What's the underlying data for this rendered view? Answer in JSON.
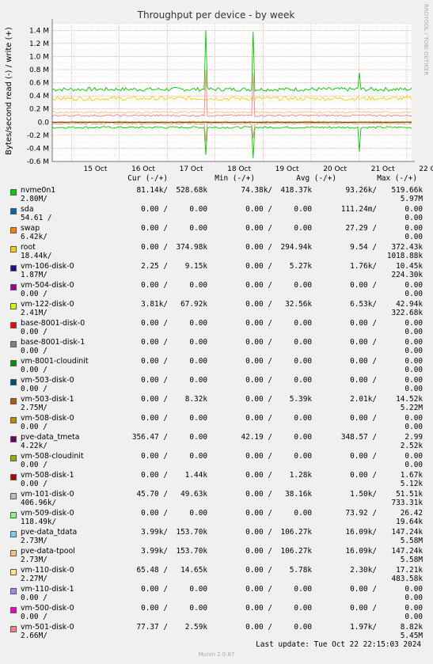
{
  "chart_data": {
    "type": "line",
    "title": "Throughput per device - by week",
    "ylabel": "Bytes/second read (-) / write (+)",
    "side_label": "RRDTOOL / TOBI OETIKER",
    "yticks": [
      "1.4 M",
      "1.2 M",
      "1.0 M",
      "0.8 M",
      "0.6 M",
      "0.4 M",
      "0.2 M",
      "0.0",
      "-0.2 M",
      "-0.4 M",
      "-0.6 M"
    ],
    "ytick_values": [
      1.4,
      1.2,
      1.0,
      0.8,
      0.6,
      0.4,
      0.2,
      0.0,
      -0.2,
      -0.4,
      -0.6
    ],
    "ylim": [
      -0.6,
      1.5
    ],
    "xticks": [
      "15 Oct",
      "16 Oct",
      "17 Oct",
      "18 Oct",
      "19 Oct",
      "20 Oct",
      "21 Oct",
      "22 Oct"
    ],
    "grid": true,
    "series": [
      {
        "name": "nvme0n1",
        "color": "#00cc00",
        "write_base": 0.5,
        "read_base": -0.08,
        "spikes": [
          {
            "day": 2.3,
            "write": 1.4,
            "read": -0.5
          },
          {
            "day": 3.3,
            "write": 1.38,
            "read": -0.55
          },
          {
            "day": 5.5,
            "write": 0.75,
            "read": -0.45
          },
          {
            "day": 6.7,
            "write": 1.1,
            "read": -0.3
          }
        ]
      },
      {
        "name": "root",
        "color": "#ffcc00",
        "write_base": 0.36,
        "read_base": 0.0,
        "spikes": []
      },
      {
        "name": "vm-501-disk-0",
        "color": "#ff8080",
        "write_base": 0.1,
        "read_base": -0.02,
        "spikes": [
          {
            "day": 2.3,
            "write": 0.8,
            "read": -0.3
          },
          {
            "day": 3.3,
            "write": 0.75,
            "read": -0.25
          }
        ]
      },
      {
        "name": "pve-data-tpool",
        "color": "#ffc080",
        "write_base": 0.15,
        "read_base": -0.02,
        "spikes": []
      }
    ]
  },
  "legend": {
    "headers": {
      "cur": "Cur (-/+)",
      "min": "Min (-/+)",
      "avg": "Avg (-/+)",
      "max": "Max (-/+)"
    },
    "rows": [
      {
        "name": "nvme0n1",
        "color": "#00cc00",
        "cur_r": "81.14k/",
        "cur_w": "528.68k",
        "min_r": "74.38k/",
        "min_w": "418.37k",
        "avg_r": "93.26k/",
        "avg_w": "519.66k",
        "max_r": "2.80M/",
        "max_w": "5.97M"
      },
      {
        "name": "sda",
        "color": "#0066b3",
        "cur_r": "0.00 /",
        "cur_w": "0.00",
        "min_r": "0.00 /",
        "min_w": "0.00",
        "avg_r": "111.24m/",
        "avg_w": "0.00",
        "max_r": "54.61 /",
        "max_w": "0.00"
      },
      {
        "name": "swap",
        "color": "#ff8000",
        "cur_r": "0.00 /",
        "cur_w": "0.00",
        "min_r": "0.00 /",
        "min_w": "0.00",
        "avg_r": "27.29 /",
        "avg_w": "0.00",
        "max_r": "6.42k/",
        "max_w": "0.00"
      },
      {
        "name": "root",
        "color": "#ffcc00",
        "cur_r": "0.00 /",
        "cur_w": "374.98k",
        "min_r": "0.00 /",
        "min_w": "294.94k",
        "avg_r": "9.54 /",
        "avg_w": "372.43k",
        "max_r": "18.44k/",
        "max_w": "1018.88k"
      },
      {
        "name": "vm-106-disk-0",
        "color": "#330099",
        "cur_r": "2.25 /",
        "cur_w": "9.15k",
        "min_r": "0.00 /",
        "min_w": "5.27k",
        "avg_r": "1.76k/",
        "avg_w": "10.45k",
        "max_r": "1.87M/",
        "max_w": "224.30k"
      },
      {
        "name": "vm-504-disk-0",
        "color": "#990099",
        "cur_r": "0.00 /",
        "cur_w": "0.00",
        "min_r": "0.00 /",
        "min_w": "0.00",
        "avg_r": "0.00 /",
        "avg_w": "0.00",
        "max_r": "0.00 /",
        "max_w": "0.00"
      },
      {
        "name": "vm-122-disk-0",
        "color": "#ccff00",
        "cur_r": "3.81k/",
        "cur_w": "67.92k",
        "min_r": "0.00 /",
        "min_w": "32.56k",
        "avg_r": "6.53k/",
        "avg_w": "42.94k",
        "max_r": "2.41M/",
        "max_w": "322.68k"
      },
      {
        "name": "base-8001-disk-0",
        "color": "#ff0000",
        "cur_r": "0.00 /",
        "cur_w": "0.00",
        "min_r": "0.00 /",
        "min_w": "0.00",
        "avg_r": "0.00 /",
        "avg_w": "0.00",
        "max_r": "0.00 /",
        "max_w": "0.00"
      },
      {
        "name": "base-8001-disk-1",
        "color": "#808080",
        "cur_r": "0.00 /",
        "cur_w": "0.00",
        "min_r": "0.00 /",
        "min_w": "0.00",
        "avg_r": "0.00 /",
        "avg_w": "0.00",
        "max_r": "0.00 /",
        "max_w": "0.00"
      },
      {
        "name": "vm-8001-cloudinit",
        "color": "#008f00",
        "cur_r": "0.00 /",
        "cur_w": "0.00",
        "min_r": "0.00 /",
        "min_w": "0.00",
        "avg_r": "0.00 /",
        "avg_w": "0.00",
        "max_r": "0.00 /",
        "max_w": "0.00"
      },
      {
        "name": "vm-503-disk-0",
        "color": "#00487d",
        "cur_r": "0.00 /",
        "cur_w": "0.00",
        "min_r": "0.00 /",
        "min_w": "0.00",
        "avg_r": "0.00 /",
        "avg_w": "0.00",
        "max_r": "0.00 /",
        "max_w": "0.00"
      },
      {
        "name": "vm-503-disk-1",
        "color": "#b35a00",
        "cur_r": "0.00 /",
        "cur_w": "8.32k",
        "min_r": "0.00 /",
        "min_w": "5.39k",
        "avg_r": "2.01k/",
        "avg_w": "14.52k",
        "max_r": "2.75M/",
        "max_w": "5.22M"
      },
      {
        "name": "vm-508-disk-0",
        "color": "#b38f00",
        "cur_r": "0.00 /",
        "cur_w": "0.00",
        "min_r": "0.00 /",
        "min_w": "0.00",
        "avg_r": "0.00 /",
        "avg_w": "0.00",
        "max_r": "0.00 /",
        "max_w": "0.00"
      },
      {
        "name": "pve-data_tmeta",
        "color": "#6b006b",
        "cur_r": "356.47 /",
        "cur_w": "0.00",
        "min_r": "42.19 /",
        "min_w": "0.00",
        "avg_r": "348.57 /",
        "avg_w": "2.99",
        "max_r": "4.22k/",
        "max_w": "2.52k"
      },
      {
        "name": "vm-508-cloudinit",
        "color": "#8fb300",
        "cur_r": "0.00 /",
        "cur_w": "0.00",
        "min_r": "0.00 /",
        "min_w": "0.00",
        "avg_r": "0.00 /",
        "avg_w": "0.00",
        "max_r": "0.00 /",
        "max_w": "0.00"
      },
      {
        "name": "vm-508-disk-1",
        "color": "#b30000",
        "cur_r": "0.00 /",
        "cur_w": "1.44k",
        "min_r": "0.00 /",
        "min_w": "1.28k",
        "avg_r": "0.00 /",
        "avg_w": "1.67k",
        "max_r": "0.00 /",
        "max_w": "5.12k"
      },
      {
        "name": "vm-101-disk-0",
        "color": "#bebebe",
        "cur_r": "45.70 /",
        "cur_w": "49.63k",
        "min_r": "0.00 /",
        "min_w": "38.16k",
        "avg_r": "1.50k/",
        "avg_w": "51.51k",
        "max_r": "406.96k/",
        "max_w": "733.31k"
      },
      {
        "name": "vm-509-disk-0",
        "color": "#80ff80",
        "cur_r": "0.00 /",
        "cur_w": "0.00",
        "min_r": "0.00 /",
        "min_w": "0.00",
        "avg_r": "73.92 /",
        "avg_w": "26.42",
        "max_r": "118.49k/",
        "max_w": "19.64k"
      },
      {
        "name": "pve-data_tdata",
        "color": "#80c9ff",
        "cur_r": "3.99k/",
        "cur_w": "153.70k",
        "min_r": "0.00 /",
        "min_w": "106.27k",
        "avg_r": "16.09k/",
        "avg_w": "147.24k",
        "max_r": "2.73M/",
        "max_w": "5.58M"
      },
      {
        "name": "pve-data-tpool",
        "color": "#ffc080",
        "cur_r": "3.99k/",
        "cur_w": "153.70k",
        "min_r": "0.00 /",
        "min_w": "106.27k",
        "avg_r": "16.09k/",
        "avg_w": "147.24k",
        "max_r": "2.73M/",
        "max_w": "5.58M"
      },
      {
        "name": "vm-110-disk-0",
        "color": "#ffe680",
        "cur_r": "65.48 /",
        "cur_w": "14.65k",
        "min_r": "0.00 /",
        "min_w": "5.78k",
        "avg_r": "2.30k/",
        "avg_w": "17.21k",
        "max_r": "2.27M/",
        "max_w": "483.58k"
      },
      {
        "name": "vm-110-disk-1",
        "color": "#aa80ff",
        "cur_r": "0.00 /",
        "cur_w": "0.00",
        "min_r": "0.00 /",
        "min_w": "0.00",
        "avg_r": "0.00 /",
        "avg_w": "0.00",
        "max_r": "0.00 /",
        "max_w": "0.00"
      },
      {
        "name": "vm-500-disk-0",
        "color": "#ee00cc",
        "cur_r": "0.00 /",
        "cur_w": "0.00",
        "min_r": "0.00 /",
        "min_w": "0.00",
        "avg_r": "0.00 /",
        "avg_w": "0.00",
        "max_r": "0.00 /",
        "max_w": "0.00"
      },
      {
        "name": "vm-501-disk-0",
        "color": "#ff8080",
        "cur_r": "77.37 /",
        "cur_w": "2.59k",
        "min_r": "0.00 /",
        "min_w": "0.00",
        "avg_r": "1.97k/",
        "avg_w": "8.82k",
        "max_r": "2.66M/",
        "max_w": "5.45M"
      }
    ]
  },
  "footer": {
    "last_update": "Last update: Tue Oct 22 22:15:03 2024",
    "munin": "Munin 2.0.67"
  }
}
